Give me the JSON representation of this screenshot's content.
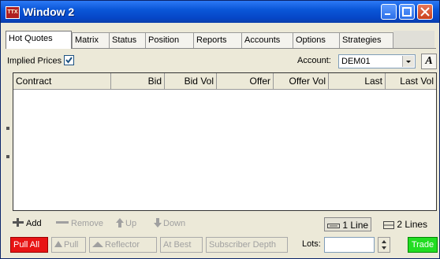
{
  "window": {
    "title": "Window 2",
    "app_icon_text": "TTX"
  },
  "tabs": [
    {
      "label": "Hot Quotes"
    },
    {
      "label": "Matrix"
    },
    {
      "label": "Status"
    },
    {
      "label": "Position"
    },
    {
      "label": "Reports"
    },
    {
      "label": "Accounts"
    },
    {
      "label": "Options"
    },
    {
      "label": "Strategies"
    }
  ],
  "options_bar": {
    "implied_prices_label": "Implied Prices",
    "implied_prices_checked": true,
    "account_label": "Account:",
    "account_value": "DEM01",
    "font_button": "A"
  },
  "grid": {
    "columns": [
      "Contract",
      "Bid",
      "Bid Vol",
      "Offer",
      "Offer Vol",
      "Last",
      "Last Vol"
    ],
    "rows": []
  },
  "toolbar": {
    "add": "Add",
    "remove": "Remove",
    "up": "Up",
    "down": "Down",
    "one_line": "1 Line",
    "two_lines": "2 Lines"
  },
  "actions": {
    "pull_all": "Pull All",
    "pull": "Pull",
    "reflector": "Reflector",
    "at_best": "At Best",
    "subscriber_depth": "Subscriber Depth",
    "lots_label": "Lots:",
    "lots_value": "",
    "trade": "Trade"
  },
  "colors": {
    "titlebar": "#0a57d8",
    "pull_all": "#e81414",
    "trade": "#22dd22"
  }
}
